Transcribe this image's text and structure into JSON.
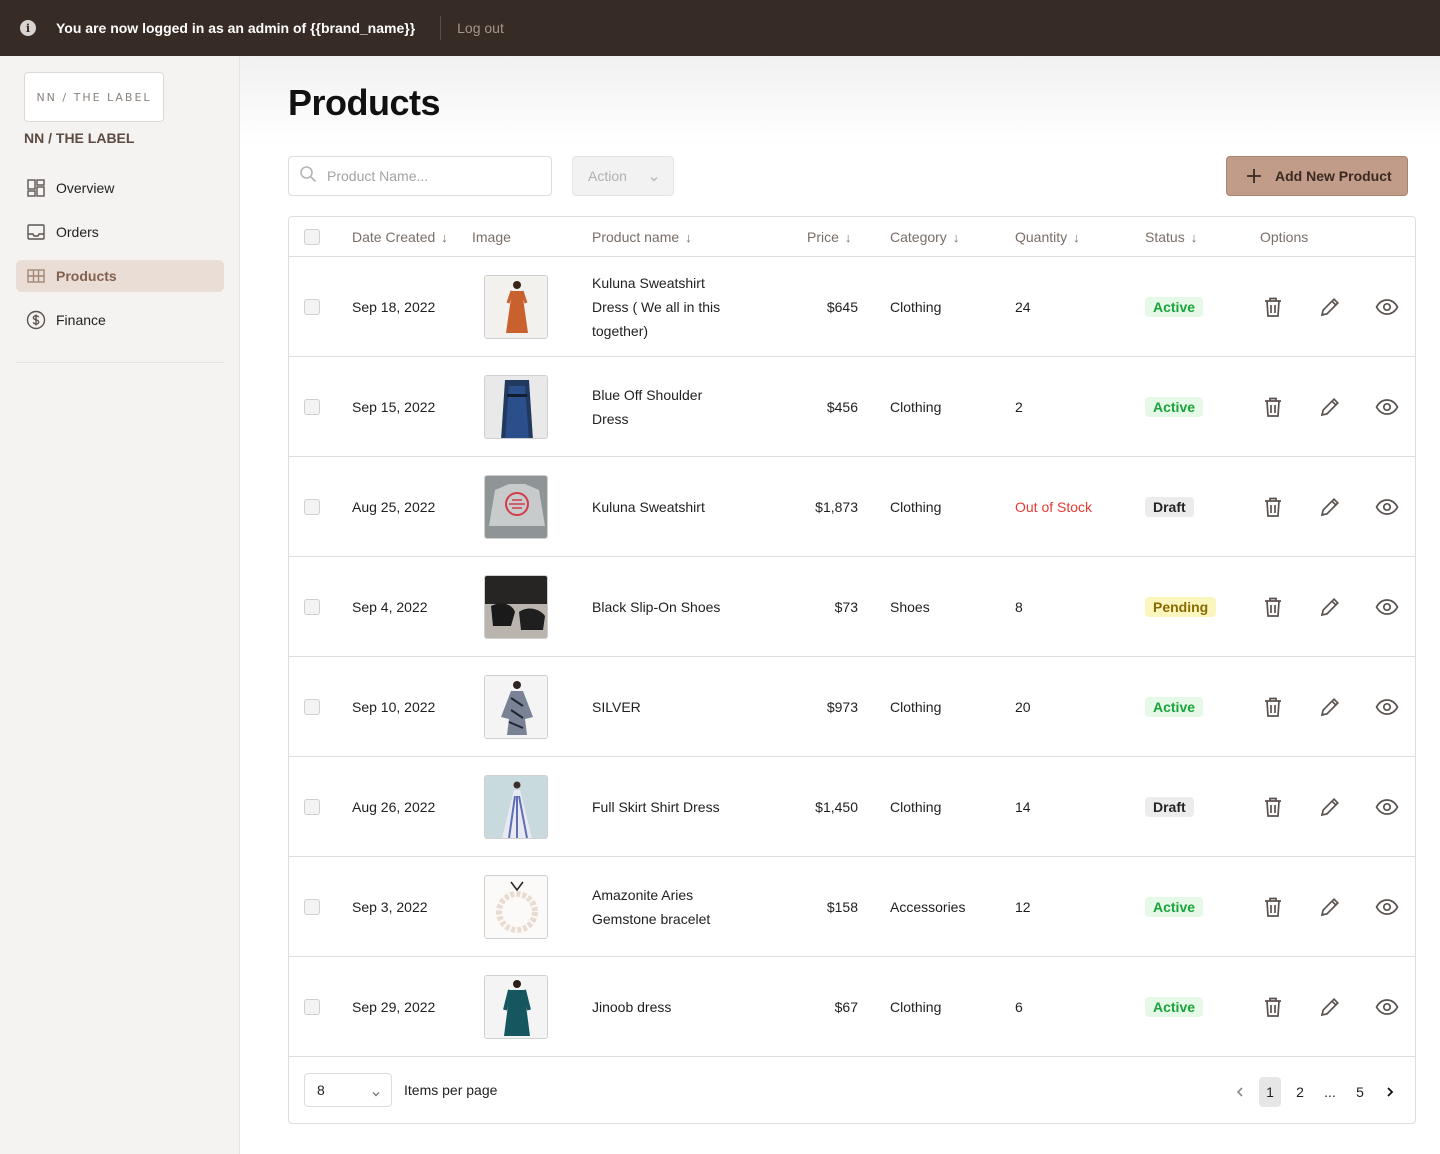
{
  "banner": {
    "message": "You are now logged in as an admin of {{brand_name}}",
    "logout_label": "Log out"
  },
  "sidebar": {
    "logo_text": "NN / THE LABEL",
    "brand_name": "NN / THE LABEL",
    "items": [
      {
        "label": "Overview",
        "icon": "grid-layout-icon",
        "active": false
      },
      {
        "label": "Orders",
        "icon": "inbox-tray-icon",
        "active": false
      },
      {
        "label": "Products",
        "icon": "table-icon",
        "active": true
      },
      {
        "label": "Finance",
        "icon": "dollar-circle-icon",
        "active": false
      }
    ]
  },
  "main": {
    "title": "Products",
    "search_placeholder": "Product Name...",
    "action_label": "Action",
    "add_button_label": "Add New Product"
  },
  "table": {
    "headers": {
      "date": "Date Created",
      "image": "Image",
      "name": "Product name",
      "price": "Price",
      "category": "Category",
      "quantity": "Quantity",
      "status": "Status",
      "options": "Options"
    },
    "rows": [
      {
        "date": "Sep 18, 2022",
        "name": "Kuluna Sweatshirt Dress ( We all in this together)",
        "price": "$645",
        "category": "Clothing",
        "quantity": "24",
        "status": "Active"
      },
      {
        "date": "Sep 15, 2022",
        "name": "Blue Off Shoulder Dress",
        "price": "$456",
        "category": "Clothing",
        "quantity": "2",
        "status": "Active"
      },
      {
        "date": "Aug 25, 2022",
        "name": "Kuluna Sweatshirt",
        "price": "$1,873",
        "category": "Clothing",
        "quantity": "Out of Stock",
        "status": "Draft"
      },
      {
        "date": "Sep 4, 2022",
        "name": "Black Slip-On Shoes",
        "price": "$73",
        "category": "Shoes",
        "quantity": "8",
        "status": "Pending"
      },
      {
        "date": "Sep 10, 2022",
        "name": "SILVER",
        "price": "$973",
        "category": "Clothing",
        "quantity": "20",
        "status": "Active"
      },
      {
        "date": "Aug 26, 2022",
        "name": "Full Skirt Shirt Dress",
        "price": "$1,450",
        "category": "Clothing",
        "quantity": "14",
        "status": "Draft"
      },
      {
        "date": "Sep 3, 2022",
        "name": "Amazonite Aries Gemstone bracelet",
        "price": "$158",
        "category": "Accessories",
        "quantity": "12",
        "status": "Active"
      },
      {
        "date": "Sep 29, 2022",
        "name": "Jinoob dress",
        "price": "$67",
        "category": "Clothing",
        "quantity": "6",
        "status": "Active"
      }
    ]
  },
  "footer": {
    "per_page_value": "8",
    "per_page_label": "Items per page",
    "pages": [
      "1",
      "2",
      "...",
      "5"
    ],
    "current_page": "1"
  },
  "colors": {
    "banner_bg": "#372b26",
    "accent": "#c19c88",
    "active_nav_bg": "#e9ddd6",
    "status_active": "#1aa33a",
    "status_pending_bg": "#fbf6bd",
    "out_of_stock": "#e53b35"
  }
}
